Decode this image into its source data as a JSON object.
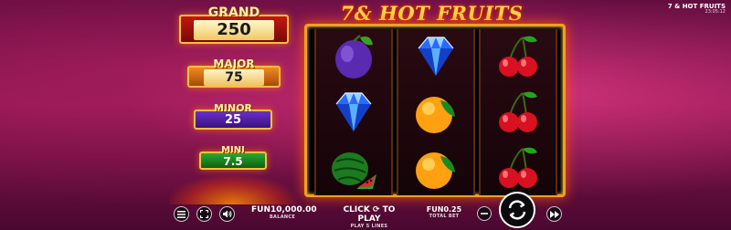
{
  "game": {
    "title": "7 & HOT FRUITS",
    "clock": "23:05:12",
    "logo_text": "7& HOT FRUITS"
  },
  "jackpots": [
    {
      "name": "GRAND",
      "value": "250"
    },
    {
      "name": "MAJOR",
      "value": "75"
    },
    {
      "name": "MINOR",
      "value": "25"
    },
    {
      "name": "MINI",
      "value": "7.5"
    }
  ],
  "reels": [
    [
      "plum",
      "diamond",
      "watermelon"
    ],
    [
      "diamond",
      "orange",
      "orange"
    ],
    [
      "cherry",
      "cherry",
      "cherry"
    ]
  ],
  "bottom_bar": {
    "balance_value": "FUN10,000.00",
    "balance_label": "BALANCE",
    "click_to_play": "CLICK ⟳ TO PLAY",
    "play_lines": "PLAY 5 LINES",
    "bet_value": "FUN0.25",
    "bet_label": "TOTAL BET"
  },
  "icons": {
    "menu": "hamburger-icon",
    "fullscreen": "fullscreen-icon",
    "sound": "speaker-icon",
    "bet_minus": "minus-icon",
    "spin": "spin-arrows-icon",
    "autoplay": "fast-forward-icon"
  },
  "colors": {
    "frame_gold": "#f0a020",
    "grand_red": "#c01810",
    "major_orange": "#f08a20",
    "minor_purple": "#6a30c8",
    "mini_green": "#2aa830"
  }
}
